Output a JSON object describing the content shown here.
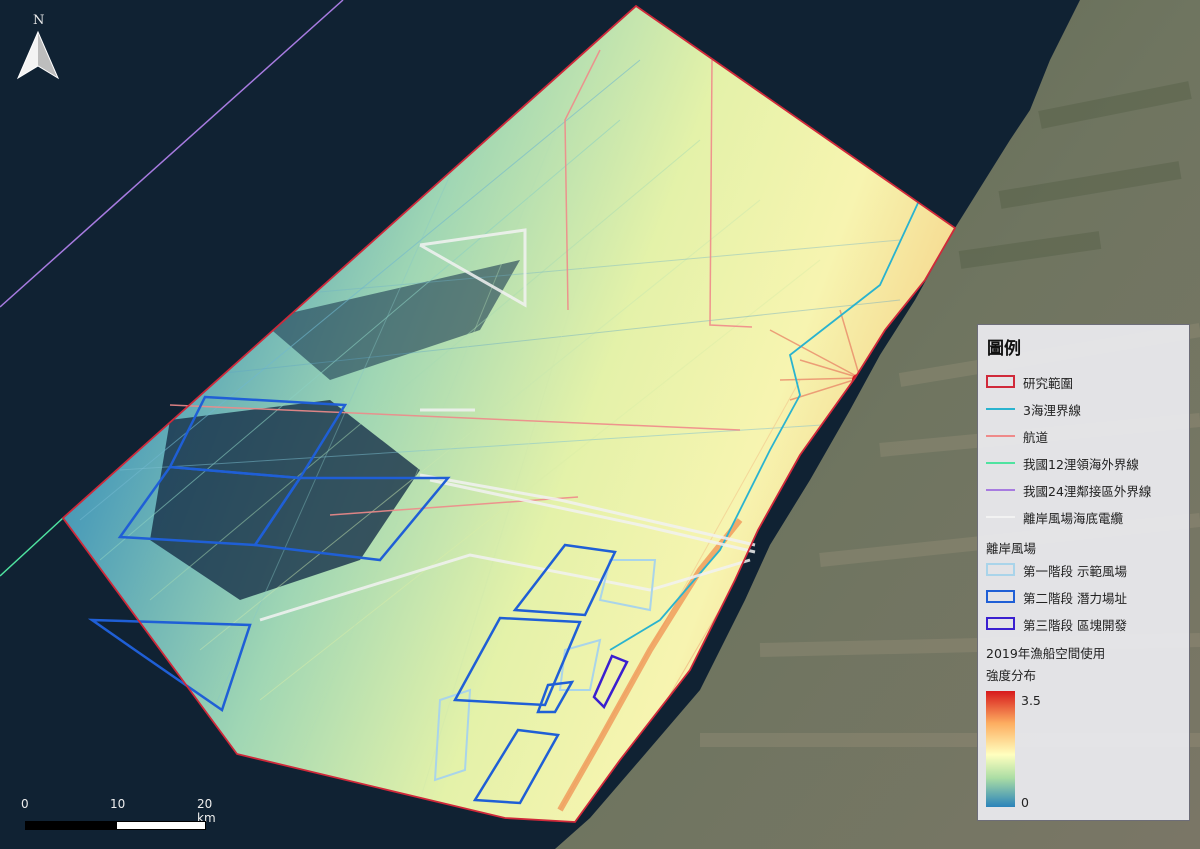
{
  "north_arrow": {
    "label": "N"
  },
  "legend": {
    "title": "圖例",
    "items": [
      {
        "label": "研究範圍",
        "symbol": "rect",
        "color": "#d0293a"
      },
      {
        "label": "3海浬界線",
        "symbol": "line",
        "color": "#2ab3cf"
      },
      {
        "label": "航道",
        "symbol": "line",
        "color": "#ef8a8a"
      },
      {
        "label": "我國12浬領海外界線",
        "symbol": "line",
        "color": "#4fe3a0"
      },
      {
        "label": "我國24浬鄰接區外界線",
        "symbol": "line",
        "color": "#a77be0"
      },
      {
        "label": "離岸風場海底電纜",
        "symbol": "line",
        "color": "#f2f2f2"
      }
    ],
    "windfarm_heading": "離岸風場",
    "windfarm_items": [
      {
        "label": "第一階段 示範風場",
        "color": "#a9d4ea"
      },
      {
        "label": "第二階段 潛力場址",
        "color": "#1f5fd6"
      },
      {
        "label": "第三階段 區塊開發",
        "color": "#3a1fd0"
      }
    ],
    "intensity_heading_line1": "2019年漁船空間使用",
    "intensity_heading_line2": "強度分布",
    "intensity_max": "3.5",
    "intensity_min": "0"
  },
  "scale": {
    "labels": [
      "0",
      "10",
      "20 km"
    ]
  }
}
